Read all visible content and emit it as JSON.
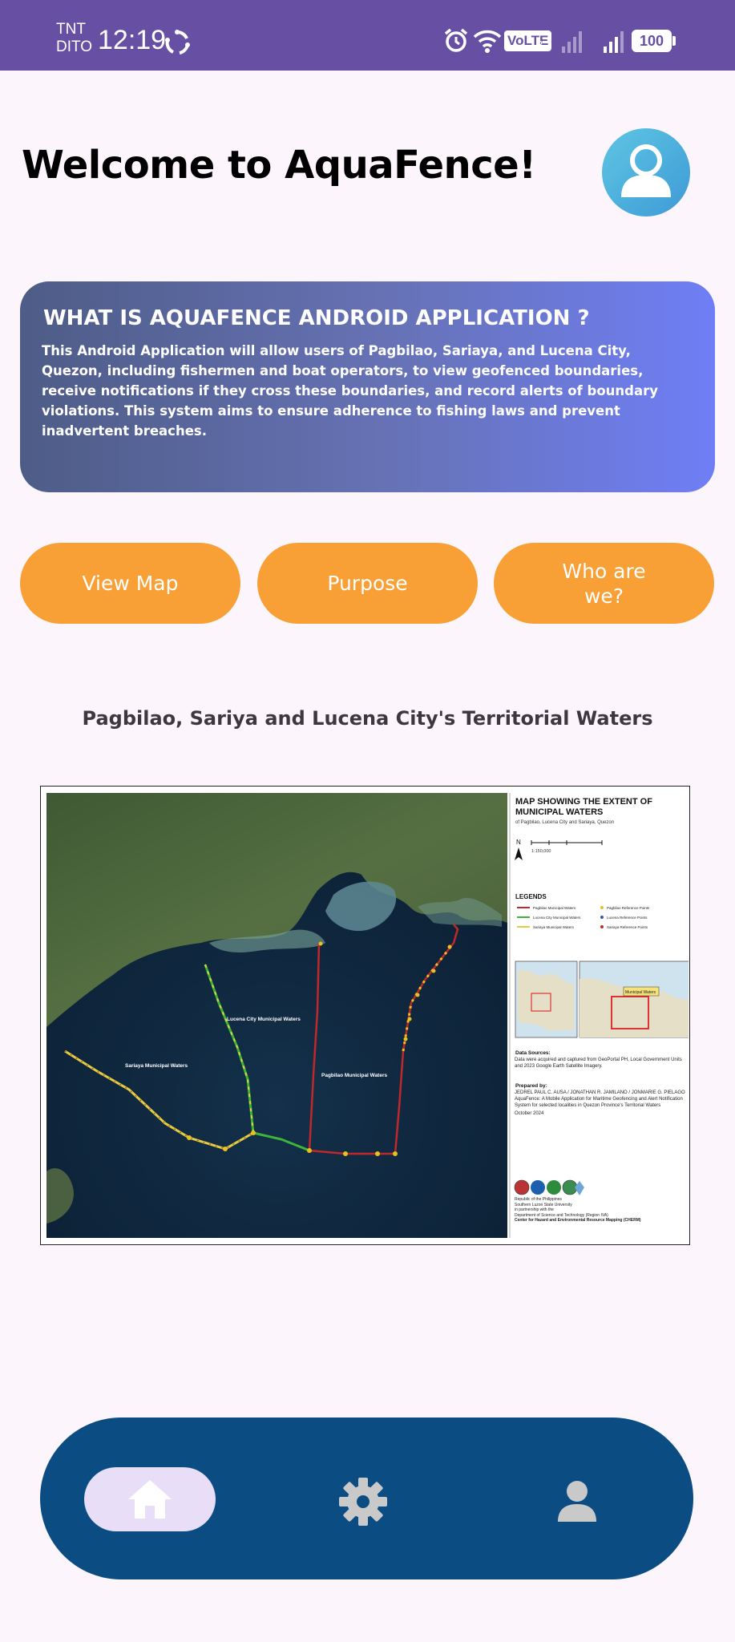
{
  "status_bar": {
    "carrier_line1": "TNT",
    "carrier_line2": "DITO",
    "time": "12:19",
    "volte_label": "VoLTE",
    "sim_slot": "2",
    "battery_level": "100",
    "icons": [
      "sync-icon",
      "alarm-icon",
      "wifi-icon",
      "signal-icon",
      "battery-icon"
    ]
  },
  "header": {
    "title": "Welcome to AquaFence!",
    "avatar_icon": "user-icon"
  },
  "info_card": {
    "title": "WHAT IS AQUAFENCE ANDROID APPLICATION ?",
    "body": "This Android Application will allow users of Pagbilao, Sariaya, and Lucena City, Quezon, including fishermen and boat operators, to view geofenced boundaries, receive notifications if they cross these boundaries, and record alerts of boundary violations. This system aims to ensure adherence to fishing laws and prevent inadvertent breaches.",
    "gradient_colors": [
      "#4E5C87",
      "#6F7EF6"
    ]
  },
  "buttons": {
    "view_map": "View Map",
    "purpose": "Purpose",
    "who_are_we": "Who are we?",
    "color": "#F8A036"
  },
  "map_section": {
    "heading": "Pagbilao, Sariya and Lucena City's Territorial Waters",
    "figure": {
      "title": "MAP SHOWING THE EXTENT OF MUNICIPAL WATERS",
      "subtitle": "of Pagbilao, Lucena City and Sariaya, Quezon",
      "north_label": "N",
      "scale": "1:150,000",
      "legend_title": "LEGENDS",
      "legend": [
        {
          "label": "Pagbilao Municipal Waters",
          "color": "#C0282C"
        },
        {
          "label": "Pagbilao Reference Points",
          "color": "#E8C020"
        },
        {
          "label": "Lucena City Municipal Waters",
          "color": "#3DB43A"
        },
        {
          "label": "Lucena Reference Points",
          "color": "#2F5BAA"
        },
        {
          "label": "Sariaya Municipal Waters",
          "color": "#E0D040"
        },
        {
          "label": "Sariaya Reference Points",
          "color": "#C03020"
        }
      ],
      "map_labels": {
        "lucena": "Lucena City Municipal Waters",
        "sariaya": "Sariaya Municipal Waters",
        "pagbilao": "Pagbilao Municipal Waters",
        "inset_label": "Municipal Waters"
      },
      "data_sources_title": "Data Sources:",
      "data_sources": "Data were acquired and captured from GeoPortal PH, Local Government Units and 2023 Google Earth Satellite Imagery.",
      "prepared_by_title": "Prepared by:",
      "prepared_by": "JEDREL PAUL C. AUSA / JONATHAN R. JAMILANO / JONMARIE G. PIELAGO",
      "project": "AquaFence: A Mobile Application for Maritime Geofencing and Alert Notification System for selected localities in Quezon Province's Territorial Waters",
      "date": "October 2024",
      "footer_lines": [
        "Republic of the Philippines",
        "Southern Luzon State University",
        "in partnership with the",
        "Department of Science and Technology (Region IVA)"
      ],
      "footer_center": "Center for Hazard and Environmental Resource Mapping (CHERM)"
    }
  },
  "bottom_nav": {
    "items": [
      {
        "name": "home",
        "icon": "home-icon",
        "active": true
      },
      {
        "name": "settings",
        "icon": "gear-icon",
        "active": false
      },
      {
        "name": "profile",
        "icon": "person-icon",
        "active": false
      }
    ],
    "background": "#0B4C82",
    "active_pill_color": "#E8DEF8"
  }
}
